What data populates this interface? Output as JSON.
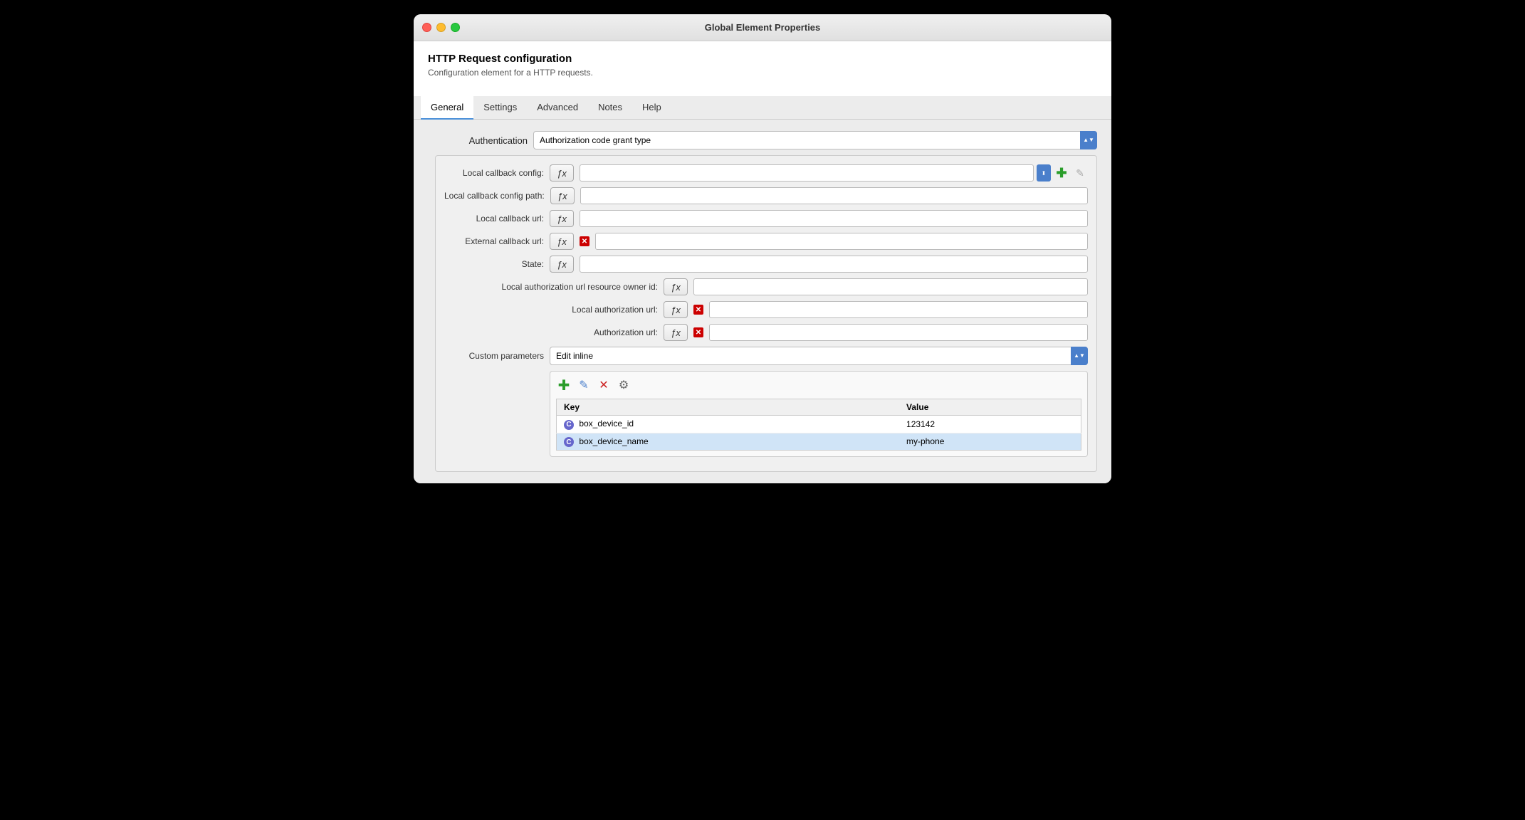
{
  "window": {
    "title": "Global Element Properties"
  },
  "header": {
    "title": "HTTP Request configuration",
    "subtitle": "Configuration element for a HTTP requests."
  },
  "tabs": [
    {
      "id": "general",
      "label": "General",
      "active": true
    },
    {
      "id": "settings",
      "label": "Settings",
      "active": false
    },
    {
      "id": "advanced",
      "label": "Advanced",
      "active": false
    },
    {
      "id": "notes",
      "label": "Notes",
      "active": false
    },
    {
      "id": "help",
      "label": "Help",
      "active": false
    }
  ],
  "authentication": {
    "label": "Authentication",
    "value": "Authorization code grant type"
  },
  "fields": [
    {
      "label": "Local callback config:",
      "type": "input-with-add",
      "hasRedX": false
    },
    {
      "label": "Local callback config path:",
      "type": "input",
      "hasRedX": false
    },
    {
      "label": "Local callback url:",
      "type": "input",
      "hasRedX": false
    },
    {
      "label": "External callback url:",
      "type": "input",
      "hasRedX": true
    },
    {
      "label": "State:",
      "type": "input",
      "hasRedX": false
    },
    {
      "label": "Local authorization url resource owner id:",
      "type": "input",
      "hasRedX": false
    },
    {
      "label": "Local authorization url:",
      "type": "input",
      "hasRedX": true
    },
    {
      "label": "Authorization url:",
      "type": "input",
      "hasRedX": true
    }
  ],
  "customParams": {
    "label": "Custom parameters",
    "selectValue": "Edit inline",
    "toolbar": {
      "add": "+",
      "edit": "✎",
      "delete": "✕",
      "settings": "⚙"
    },
    "table": {
      "columns": [
        "Key",
        "Value"
      ],
      "rows": [
        {
          "key": "box_device_id",
          "value": "123142",
          "selected": false
        },
        {
          "key": "box_device_name",
          "value": "my-phone",
          "selected": true
        }
      ]
    }
  },
  "icons": {
    "fx": "ƒx",
    "add": "✚",
    "edit": "✎",
    "delete": "✕",
    "wrench": "⚙",
    "circle": "C",
    "red_x": "✕",
    "chevron_up_down": "⬍"
  }
}
